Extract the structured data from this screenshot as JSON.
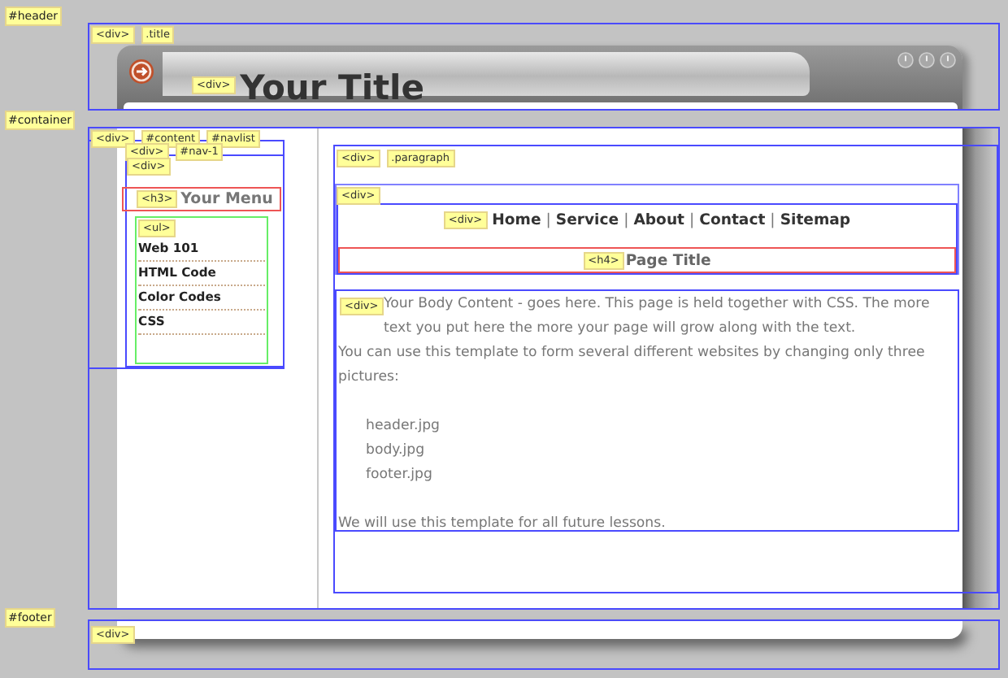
{
  "header": {
    "label": "#header",
    "tags": [
      "<div>",
      ".title"
    ],
    "title_tag": "<div>",
    "title": "Your Title"
  },
  "container": {
    "label": "#container",
    "tags": [
      "<div>",
      "#content",
      "#navlist"
    ],
    "nav_tags": [
      "<div>",
      "#nav-1"
    ],
    "nav_inner_tag": "<div>",
    "menu_tag": "<h3>",
    "menu_title": "Your Menu",
    "list_tag": "<ul>",
    "menu_items": [
      "Web 101",
      "HTML Code",
      "Color Codes",
      "CSS"
    ]
  },
  "content": {
    "tags": [
      "<div>",
      ".paragraph"
    ],
    "wrapper_tag": "<div>",
    "links_tag": "<div>",
    "separator": "|",
    "links": [
      "Home",
      "Service",
      "About",
      "Contact",
      "Sitemap"
    ],
    "page_title_tag": "<h4>",
    "page_title": "Page Title",
    "body_tag": "<div>",
    "paragraphs": [
      "Your Body Content - goes here. This page is held together with CSS. The more text you put here the more your page will grow along with the text.",
      "You can use this template to form several different websites by changing only three pictures:"
    ],
    "files": [
      "header.jpg",
      "body.jpg",
      "footer.jpg"
    ],
    "closing": "We will use this template for all future lessons."
  },
  "footer": {
    "label": "#footer",
    "tag": "<div>"
  }
}
